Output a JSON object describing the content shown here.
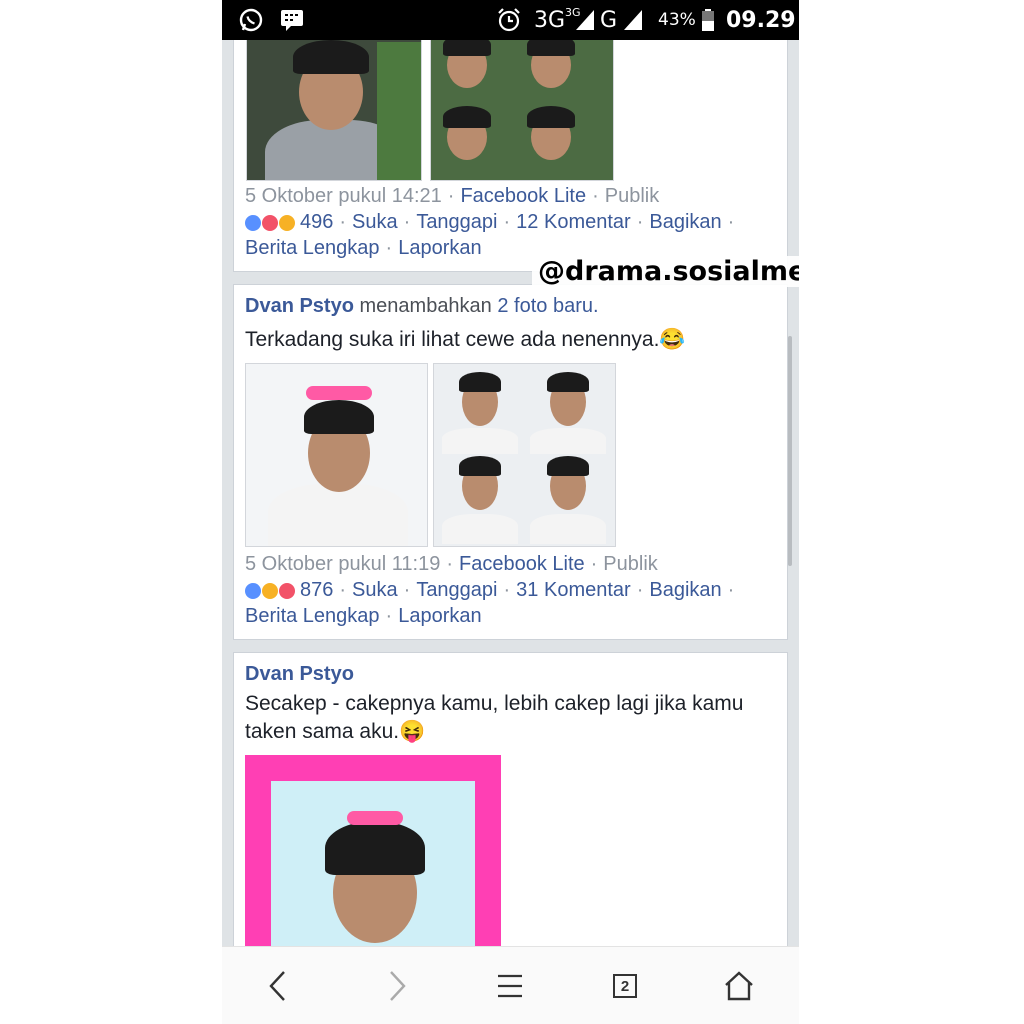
{
  "status_bar": {
    "network_1": "3G",
    "network_1_sup": "3G",
    "network_2": "G",
    "battery": "43%",
    "time": "09.29",
    "icons": [
      "whatsapp-icon",
      "bbm-icon",
      "alarm-icon",
      "signal-icon",
      "battery-icon"
    ]
  },
  "watermark": "@drama.sosialmedia",
  "posts": [
    {
      "date": "5 Oktober pukul 14:21",
      "source": "Facebook Lite",
      "privacy": "Publik",
      "reactions": [
        "like",
        "love",
        "haha"
      ],
      "count": "496",
      "like": "Suka",
      "reply": "Tanggapi",
      "comments": "12 Komentar",
      "share": "Bagikan",
      "full_story": "Berita Lengkap",
      "report": "Laporkan"
    },
    {
      "author": "Dvan Pstyo",
      "action": "menambahkan",
      "action_link": "2 foto baru.",
      "text": "Terkadang suka iri lihat cewe ada nenennya.😂",
      "date": "5 Oktober pukul 11:19",
      "source": "Facebook Lite",
      "privacy": "Publik",
      "reactions": [
        "like",
        "haha",
        "love"
      ],
      "count": "876",
      "like": "Suka",
      "reply": "Tanggapi",
      "comments": "31 Komentar",
      "share": "Bagikan",
      "full_story": "Berita Lengkap",
      "report": "Laporkan"
    },
    {
      "author": "Dvan Pstyo",
      "text": "Secakep - cakepnya kamu, lebih cakep lagi jika kamu taken sama aku.😝"
    }
  ],
  "nav": {
    "tab_count": "2",
    "icons": [
      "back-icon",
      "forward-icon",
      "menu-icon",
      "tabs-icon",
      "home-icon"
    ]
  },
  "colors": {
    "link": "#3b5998",
    "meta": "#8d949e",
    "like": "#5890ff",
    "love": "#f25268",
    "haha": "#f7b125",
    "frame_pink": "#ff3fb4"
  }
}
